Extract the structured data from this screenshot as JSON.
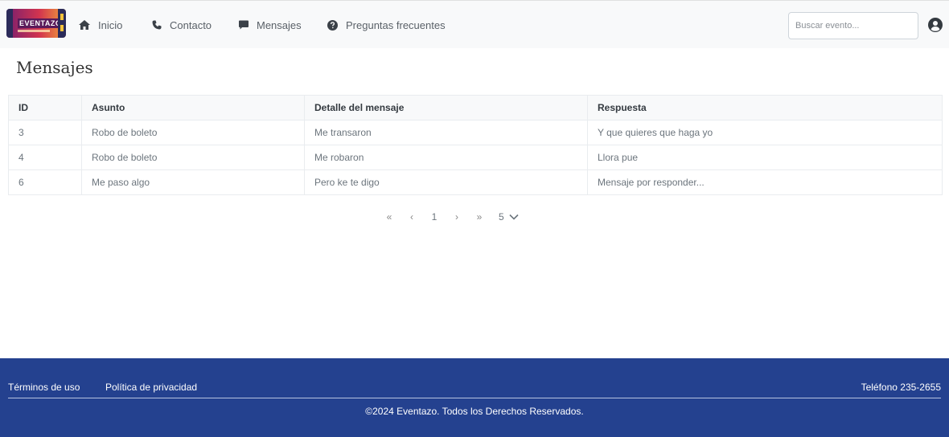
{
  "brand": {
    "logo_text": "EVENTAZO"
  },
  "nav": {
    "inicio": "Inicio",
    "contacto": "Contacto",
    "mensajes": "Mensajes",
    "faq": "Preguntas frecuentes",
    "icons": [
      "home-icon",
      "phone-icon",
      "message-icon",
      "question-circle-icon"
    ]
  },
  "search": {
    "placeholder": "Buscar evento...",
    "value": ""
  },
  "page": {
    "title": "Mensajes"
  },
  "table": {
    "headers": [
      "ID",
      "Asunto",
      "Detalle del mensaje",
      "Respuesta"
    ],
    "rows": [
      [
        "3",
        "Robo de boleto",
        "Me transaron",
        "Y que quieres que haga yo"
      ],
      [
        "4",
        "Robo de boleto",
        "Me robaron",
        "Llora pue"
      ],
      [
        "6",
        "Me paso algo",
        "Pero ke te digo",
        "Mensaje por responder..."
      ]
    ]
  },
  "paginator": {
    "first": "«",
    "prev": "‹",
    "page": "1",
    "next": "›",
    "last": "»",
    "rows_per_page": "5"
  },
  "footer": {
    "terms": "Términos de uso",
    "privacy": "Política de privacidad",
    "phone": "Teléfono 235-2655",
    "copyright": "©2024 Eventazo. Todos los Derechos Reservados.",
    "background": "#24418f"
  }
}
